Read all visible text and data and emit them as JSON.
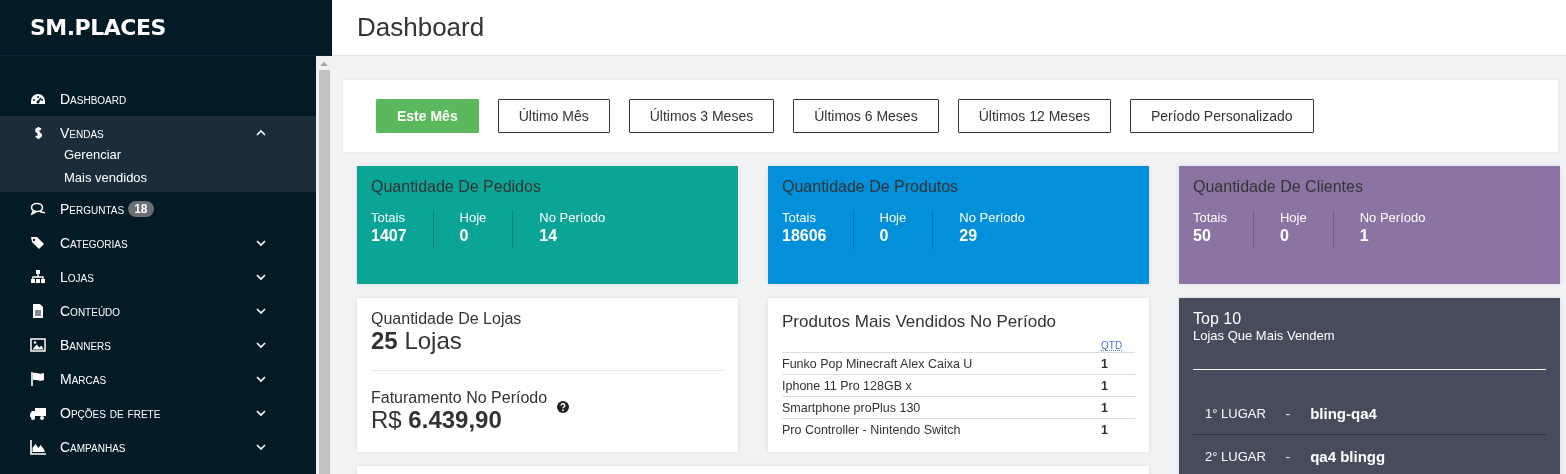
{
  "sidebar": {
    "logo": "SM.PLACES",
    "items": [
      {
        "label": "Dashboard"
      },
      {
        "label": "Vendas",
        "expanded": true,
        "children": [
          {
            "label": "Gerenciar"
          },
          {
            "label": "Mais vendidos"
          }
        ]
      },
      {
        "label": "Perguntas",
        "badge": "18"
      },
      {
        "label": "Categorias",
        "expanded": false
      },
      {
        "label": "Lojas",
        "expanded": false
      },
      {
        "label": "Conteúdo",
        "expanded": false
      },
      {
        "label": "Banners",
        "expanded": false
      },
      {
        "label": "Marcas",
        "expanded": false
      },
      {
        "label": "Opções de frete",
        "expanded": false
      },
      {
        "label": "Campanhas",
        "expanded": false
      }
    ]
  },
  "header": {
    "title": "Dashboard"
  },
  "period_filters": [
    {
      "label": "Este Mês",
      "selected": true
    },
    {
      "label": "Último Mês",
      "selected": false
    },
    {
      "label": "Últimos 3 Meses",
      "selected": false
    },
    {
      "label": "Últimos 6 Meses",
      "selected": false
    },
    {
      "label": "Últimos 12 Meses",
      "selected": false
    },
    {
      "label": "Período Personalizado",
      "selected": false
    }
  ],
  "stat_cards": [
    {
      "title": "Quantidade De Pedidos",
      "color": "#0ba597",
      "metrics": [
        {
          "label": "Totais",
          "value": "1407"
        },
        {
          "label": "Hoje",
          "value": "0"
        },
        {
          "label": "No Período",
          "value": "14"
        }
      ]
    },
    {
      "title": "Quantidade De Produtos",
      "color": "#0190d9",
      "metrics": [
        {
          "label": "Totais",
          "value": "18606"
        },
        {
          "label": "Hoje",
          "value": "0"
        },
        {
          "label": "No Período",
          "value": "29"
        }
      ]
    },
    {
      "title": "Quantidade De Clientes",
      "color": "#8b74a4",
      "metrics": [
        {
          "label": "Totais",
          "value": "50"
        },
        {
          "label": "Hoje",
          "value": "0"
        },
        {
          "label": "No Período",
          "value": "1"
        }
      ]
    }
  ],
  "stores_card": {
    "title": "Quantidade De Lojas",
    "count": "25",
    "unit": "Lojas",
    "revenue_title": "Faturamento No Período",
    "currency": "R$",
    "revenue": "6.439,90"
  },
  "top_products": {
    "title": "Produtos Mais Vendidos No Período",
    "columns": [
      "QTD"
    ],
    "rows": [
      {
        "name": "Funko Pop Minecraft Alex Caixa U",
        "qty": "1"
      },
      {
        "name": "Iphone 11 Pro 128GB x",
        "qty": "1"
      },
      {
        "name": "Smartphone proPlus 130",
        "qty": "1"
      },
      {
        "name": "Pro Controller - Nintendo Switch",
        "qty": "1"
      }
    ]
  },
  "top_stores": {
    "title": "Top 10",
    "subtitle": "Lojas Que Mais Vendem",
    "rows": [
      {
        "rank": "1° LUGAR",
        "separator": "-",
        "name": "bling-qa4"
      },
      {
        "rank": "2° LUGAR",
        "separator": "-",
        "name": "qa4 blingg"
      }
    ]
  }
}
